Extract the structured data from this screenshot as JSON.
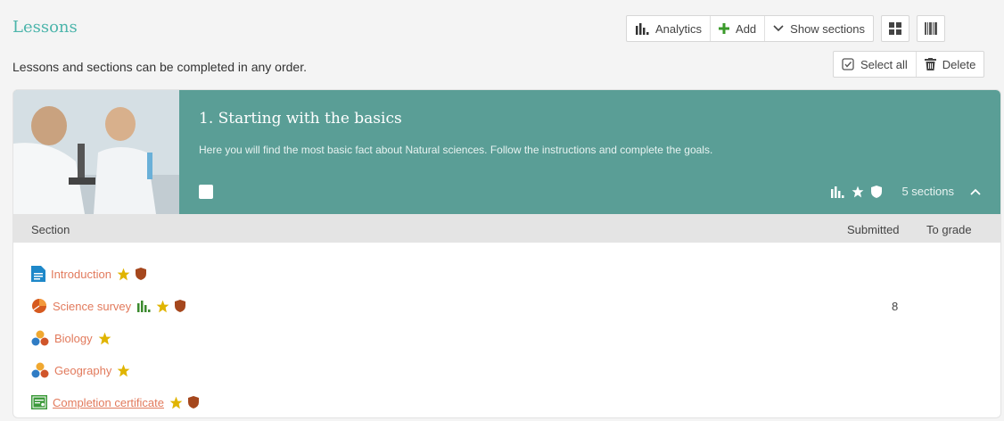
{
  "header": {
    "title": "Lessons",
    "subtitle": "Lessons and sections can be completed in any order."
  },
  "toolbar": {
    "analytics_label": "Analytics",
    "add_label": "Add",
    "show_sections_label": "Show sections",
    "select_all_label": "Select all",
    "delete_label": "Delete"
  },
  "lesson": {
    "title": "1. Starting with the basics",
    "description": "Here you will find the most basic fact about Natural sciences. Follow the instructions and complete the goals.",
    "sections_count": "5 sections"
  },
  "table": {
    "col_section": "Section",
    "col_submitted": "Submitted",
    "col_to_grade": "To grade",
    "rows": [
      {
        "name": "Introduction",
        "icon": "document-icon",
        "submitted": ""
      },
      {
        "name": "Science survey",
        "icon": "pie-chart-icon",
        "submitted": "8"
      },
      {
        "name": "Biology",
        "icon": "molecules-icon",
        "submitted": ""
      },
      {
        "name": "Geography",
        "icon": "molecules-icon",
        "submitted": ""
      },
      {
        "name": "Completion certificate",
        "icon": "certificate-icon",
        "submitted": ""
      }
    ]
  },
  "colors": {
    "accent": "#4cb5ab",
    "banner": "#5a9e96",
    "link": "#e27a5c",
    "star": "#e0b400",
    "shield": "#a5471d",
    "analytics_green": "#3b8a2e"
  }
}
